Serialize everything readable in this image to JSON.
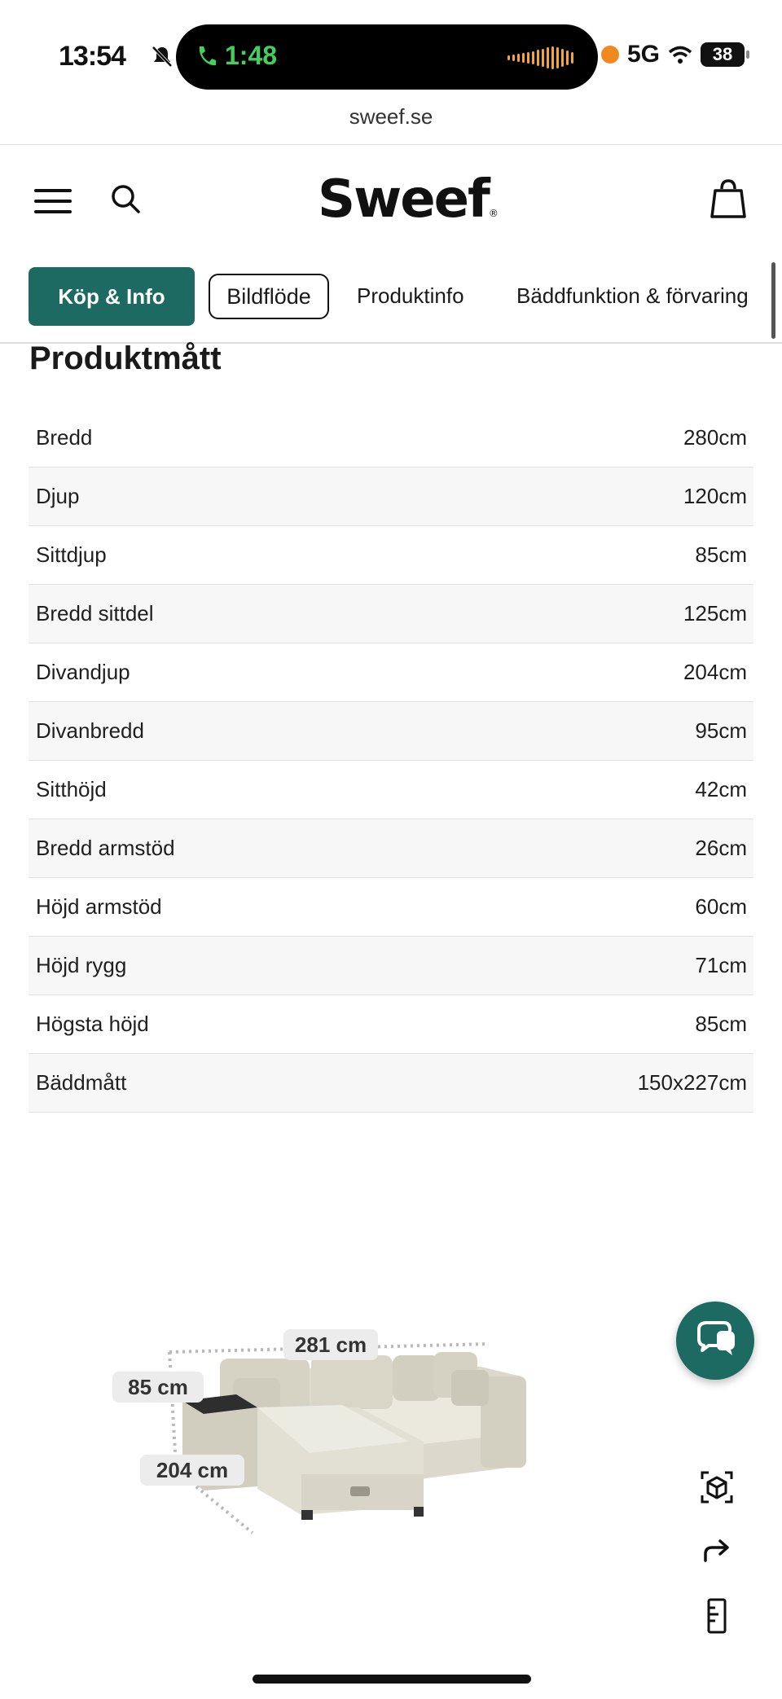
{
  "status_bar": {
    "time": "13:54",
    "call_time": "1:48",
    "network": "5G",
    "battery": "38"
  },
  "browser": {
    "url": "sweef.se"
  },
  "header": {
    "logo": "Sweef",
    "logo_mark": "®"
  },
  "tabs": [
    {
      "label": "Köp & Info"
    },
    {
      "label": "Bildflöde"
    },
    {
      "label": "Produktinfo"
    },
    {
      "label": "Bäddfunktion & förvaring"
    }
  ],
  "section": {
    "title": "Produktmått"
  },
  "specs": [
    {
      "label": "Bredd",
      "value": "280cm"
    },
    {
      "label": "Djup",
      "value": "120cm"
    },
    {
      "label": "Sittdjup",
      "value": "85cm"
    },
    {
      "label": "Bredd sittdel",
      "value": "125cm"
    },
    {
      "label": "Divandjup",
      "value": "204cm"
    },
    {
      "label": "Divanbredd",
      "value": "95cm"
    },
    {
      "label": "Sitthöjd",
      "value": "42cm"
    },
    {
      "label": "Bredd armstöd",
      "value": "26cm"
    },
    {
      "label": "Höjd armstöd",
      "value": "60cm"
    },
    {
      "label": "Höjd rygg",
      "value": "71cm"
    },
    {
      "label": "Högsta höjd",
      "value": "85cm"
    },
    {
      "label": "Bäddmått",
      "value": "150x227cm"
    }
  ],
  "product_image": {
    "width_label": "281 cm",
    "height_label": "85 cm",
    "depth_label": "204 cm"
  },
  "colors": {
    "brand": "#1d6a62",
    "call_green": "#43d05a",
    "audio_orange": "#f3a72f"
  },
  "icons": {
    "menu": "menu-icon",
    "search": "search-icon",
    "bag": "bag-icon",
    "chat": "chat-icon",
    "ar": "ar-cube-icon",
    "share": "share-icon",
    "measure": "ruler-icon"
  }
}
